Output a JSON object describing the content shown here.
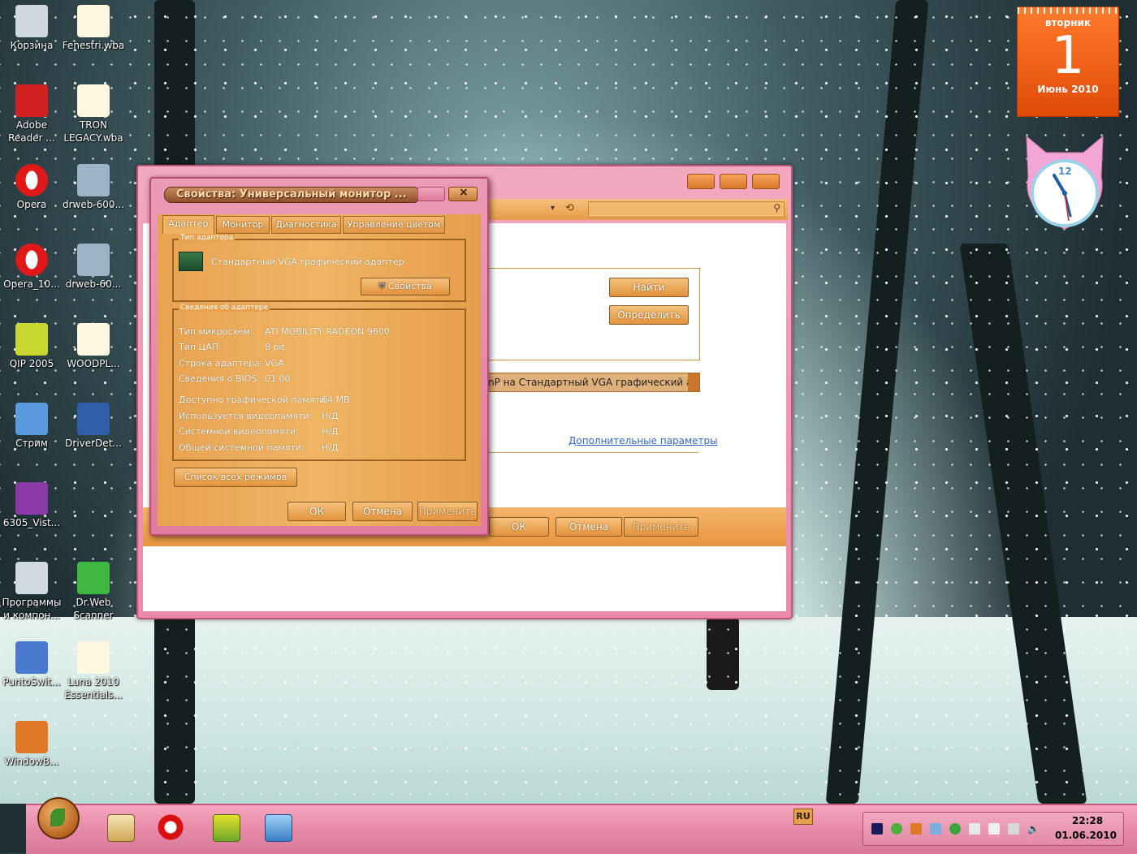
{
  "desktop_icons": [
    {
      "label": "Корзина",
      "icon": "recycle-bin-icon"
    },
    {
      "label": "Fenestri.wba",
      "icon": "theme-file-icon"
    },
    {
      "label": "Adobe Reader ...",
      "icon": "adobe-reader-icon"
    },
    {
      "label": "TRON LEGACY.wba",
      "icon": "theme-file-icon"
    },
    {
      "label": "Opera",
      "icon": "opera-icon"
    },
    {
      "label": "drweb-600...",
      "icon": "installer-icon"
    },
    {
      "label": "Opera_10...",
      "icon": "opera-icon"
    },
    {
      "label": "drweb-60...",
      "icon": "installer-icon"
    },
    {
      "label": "QIP 2005",
      "icon": "qip-icon"
    },
    {
      "label": "WOODPL...",
      "icon": "theme-file-icon"
    },
    {
      "label": "Стрим",
      "icon": "network-icon"
    },
    {
      "label": "DriverDet...",
      "icon": "driver-icon"
    },
    {
      "label": "6305_Vist...",
      "icon": "archive-icon"
    },
    {
      "label": "Программы и компон...",
      "icon": "programs-icon"
    },
    {
      "label": "Dr.Web Scanner",
      "icon": "drweb-scanner-icon"
    },
    {
      "label": "PuntoSwit...",
      "icon": "punto-icon"
    },
    {
      "label": "Luna 2010 Essentials...",
      "icon": "theme-file-icon"
    },
    {
      "label": "WindowB...",
      "icon": "windowblinds-icon"
    }
  ],
  "calendar": {
    "weekday": "вторник",
    "day": "1",
    "month_year": "Июнь 2010"
  },
  "clock": {
    "twelve": "12"
  },
  "main_window": {
    "find_button": "Найти",
    "detect_button": "Определить",
    "display_select": "nP на Стандартный VGA графический адапт",
    "advanced_link": "Дополнительные параметры",
    "ok": "ОК",
    "cancel": "Отмена",
    "apply": "Применить"
  },
  "dialog": {
    "title": "Свойства: Универсальный монитор ...",
    "tabs": [
      "Адаптер",
      "Монитор",
      "Диагностика",
      "Управление цветом"
    ],
    "adapter_type_group": "Тип адаптера",
    "adapter_name": "Стандартный VGA графический адаптер",
    "properties_button": "Свойства",
    "adapter_info_group": "Сведения об адаптере",
    "info_rows": [
      {
        "label": "Тип микросхем:",
        "value": "ATI MOBILITY RADEON 9600"
      },
      {
        "label": "Тип ЦАП:",
        "value": "8 bit"
      },
      {
        "label": "Строка адаптера:",
        "value": "VGA"
      },
      {
        "label": "Сведения о BIOS:",
        "value": "01.00"
      }
    ],
    "memory_rows": [
      {
        "label": "Доступно графической памяти:",
        "value": "64 MB"
      },
      {
        "label": "Используется видеопамяти:",
        "value": "Н/Д"
      },
      {
        "label": "Системной видеопамяти:",
        "value": "Н/Д"
      },
      {
        "label": "Общей системной памяти:",
        "value": "Н/Д"
      }
    ],
    "list_modes_button": "Список всех режимов",
    "ok": "ОК",
    "cancel": "Отмена",
    "apply": "Применить"
  },
  "taskbar": {
    "language": "RU",
    "time": "22:28",
    "date": "01.06.2010",
    "pinned": [
      "media-player-icon",
      "opera-icon",
      "qip-icon",
      "control-panel-icon"
    ]
  },
  "colors": {
    "accent_pink": "#e98aa8",
    "accent_orange": "#e8963f",
    "calendar_orange": "#e04b08"
  }
}
